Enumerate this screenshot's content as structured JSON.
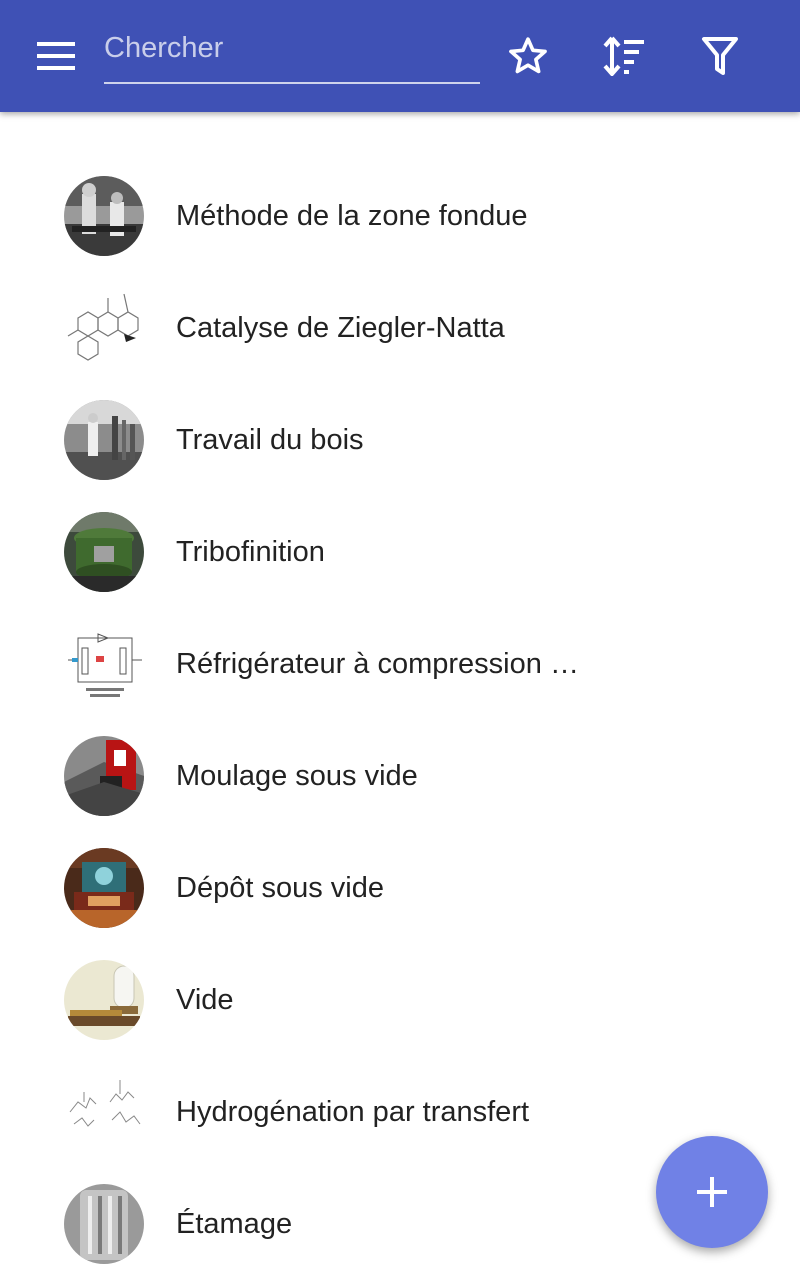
{
  "appbar": {
    "background": "#3f51b5",
    "menu_icon": "hamburger-menu-icon",
    "search": {
      "placeholder": "Chercher",
      "value": ""
    },
    "actions": [
      {
        "icon": "star-outline-icon"
      },
      {
        "icon": "sort-icon"
      },
      {
        "icon": "filter-icon"
      }
    ]
  },
  "list": {
    "items": [
      {
        "label": "Méthode de la zone fondue",
        "thumbnail": "photo-men-lab-bw"
      },
      {
        "label": "Catalyse de Ziegler-Natta",
        "thumbnail": "chemical-structure"
      },
      {
        "label": "Travail du bois",
        "thumbnail": "photo-workshop-bw"
      },
      {
        "label": "Tribofinition",
        "thumbnail": "photo-vibratory-machine"
      },
      {
        "label": "Réfrigérateur à compression …",
        "thumbnail": "schematic-diagram"
      },
      {
        "label": "Moulage sous vide",
        "thumbnail": "red-machine-render"
      },
      {
        "label": "Dépôt sous vide",
        "thumbnail": "photo-chamber"
      },
      {
        "label": "Vide",
        "thumbnail": "photo-bell-jar"
      },
      {
        "label": "Hydrogénation par transfert",
        "thumbnail": "chemical-structure"
      },
      {
        "label": "Étamage",
        "thumbnail": "photo-metal-cylinder"
      }
    ]
  },
  "fab": {
    "icon": "plus-icon",
    "color": "#7081e6"
  }
}
